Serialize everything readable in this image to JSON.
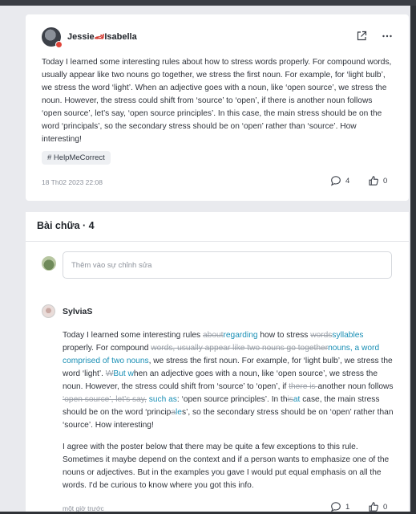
{
  "post": {
    "author": "Jessie",
    "author_suffix": "Isabella",
    "author_emoji": "🏎",
    "body": "Today I learned some interesting rules about how to stress words properly. For compound words, usually appear like two nouns go together, we stress the first noun. For example, for ‘light bulb’, we stress the word ‘light’. When an adjective goes with a noun, like ‘open source’, we stress the noun. However, the stress could shift from ‘source’ to ‘open’, if there is another noun follows ‘open source’, let’s say, ‘open source principles’. In this case, the main stress should be on the word ‘principals’, so the secondary stress should be on ‘open’ rather than ‘source’. How interesting!",
    "hashtag": "# HelpMeCorrect",
    "timestamp": "18 Th02 2023 22:08",
    "comments_count": "4",
    "likes_count": "0"
  },
  "corrections": {
    "title": "Bài chữa · 4",
    "input_placeholder": "Thêm vào sự chỉnh sửa",
    "item": {
      "author": "SylviaS",
      "segments": [
        {
          "t": "Today I learned some interesting rules ",
          "k": "keep"
        },
        {
          "t": "about",
          "k": "del"
        },
        {
          "t": "regarding",
          "k": "ins"
        },
        {
          "t": " how to stress ",
          "k": "keep"
        },
        {
          "t": "words",
          "k": "del"
        },
        {
          "t": "syllables",
          "k": "ins"
        },
        {
          "t": " properly. For compound ",
          "k": "keep"
        },
        {
          "t": "words, usually appear like two nouns go together",
          "k": "del"
        },
        {
          "t": "nouns, a word comprised of two nouns",
          "k": "ins"
        },
        {
          "t": ", we stress the first noun. For example, for ‘light bulb’, we stress the word ‘light’. ",
          "k": "keep"
        },
        {
          "t": "W",
          "k": "del"
        },
        {
          "t": "But w",
          "k": "ins"
        },
        {
          "t": "hen an adjective goes with a noun, like ‘open source’, we stress the noun. However, the stress could shift from ‘source’ to ‘open’, if ",
          "k": "keep"
        },
        {
          "t": "there is ",
          "k": "del"
        },
        {
          "t": "another noun follows",
          "k": "keep"
        },
        {
          "t": " ‘open source’, let’s say,",
          "k": "del"
        },
        {
          "t": " such as",
          "k": "ins"
        },
        {
          "t": ": ‘open source principles’. In th",
          "k": "keep"
        },
        {
          "t": "is",
          "k": "del"
        },
        {
          "t": "at",
          "k": "ins"
        },
        {
          "t": " case, the main stress should be on the word ‘princip",
          "k": "keep"
        },
        {
          "t": "a",
          "k": "del"
        },
        {
          "t": "le",
          "k": "ins"
        },
        {
          "t": "s’, so the secondary stress should be on ‘open’ rather than ‘source’. How interesting!",
          "k": "keep"
        }
      ],
      "comment": "I agree with the poster below that there may be quite a few exceptions to this rule. Sometimes it maybe depend on the context and if a person wants to emphasize one of the nouns or adjectives. But in the examples you gave I would put equal emphasis on all the words. I'd be curious to know where you got this info.",
      "timestamp": "một giờ trước",
      "comments_count": "1",
      "likes_count": "0"
    }
  },
  "colors": {
    "insert": "#1a8fb5",
    "delete": "#9aa0a8",
    "badge": "#e0443a"
  },
  "icons": [
    "share-icon",
    "more-icon",
    "comment-icon",
    "like-icon"
  ]
}
